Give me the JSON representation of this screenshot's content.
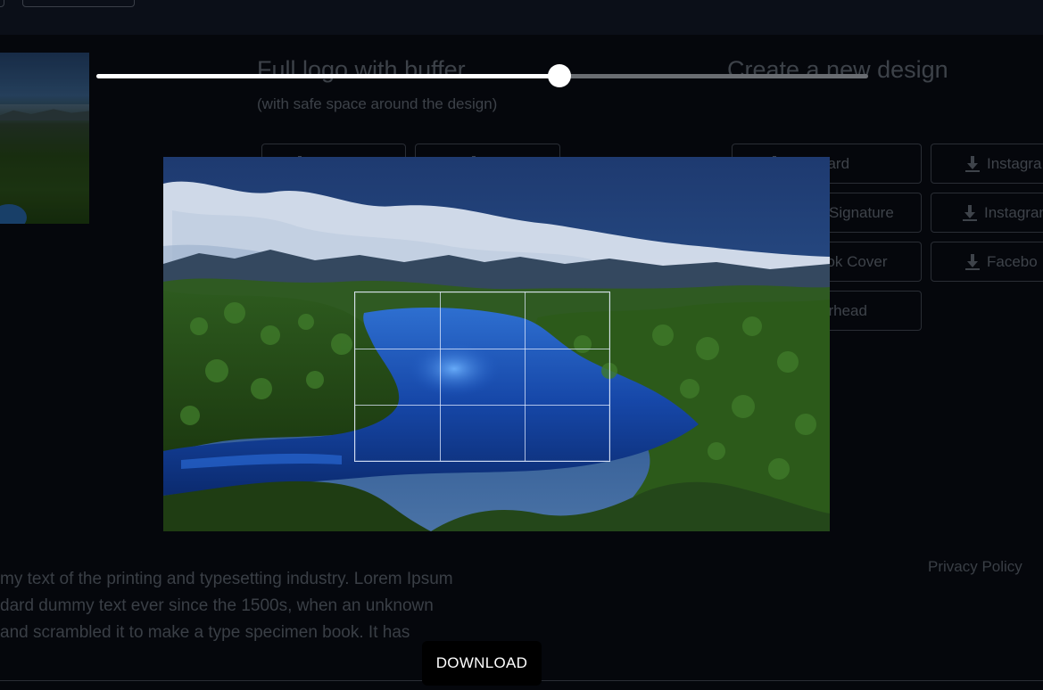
{
  "background": {
    "sections": [
      {
        "heading": "Full logo with buffer",
        "subheading": "(with safe space around the design)"
      },
      {
        "heading": "Create a new design"
      }
    ],
    "format_buttons": [
      {
        "label": "ess Card",
        "icon": "download-icon"
      },
      {
        "label": "Instagra",
        "icon": "download-icon"
      },
      {
        "label": "Signature",
        "icon": "download-icon"
      },
      {
        "label": "Instagran",
        "icon": "download-icon"
      },
      {
        "label": "ook Cover",
        "icon": "download-icon"
      },
      {
        "label": "Facebo",
        "icon": "download-icon"
      },
      {
        "label": "erhead",
        "icon": "download-icon"
      }
    ],
    "paragraph_lines": [
      "my text of the printing and typesetting industry. Lorem Ipsum",
      "dard dummy text ever since the 1500s, when an unknown",
      "and scrambled it to make a type specimen book. It has"
    ],
    "privacy_link": "Privacy Policy"
  },
  "crop_modal": {
    "zoom_slider": {
      "value": 0.6
    },
    "grid": {
      "rows": 3,
      "columns": 3
    },
    "download_label": "DOWNLOAD"
  },
  "colors": {
    "page_background": "#05070c",
    "topbar": "#0b0f18",
    "dimmed_text": "#3d4249",
    "slider_fill": "#ffffff",
    "slider_track": "#6a6d72",
    "download_button": "#000000"
  }
}
